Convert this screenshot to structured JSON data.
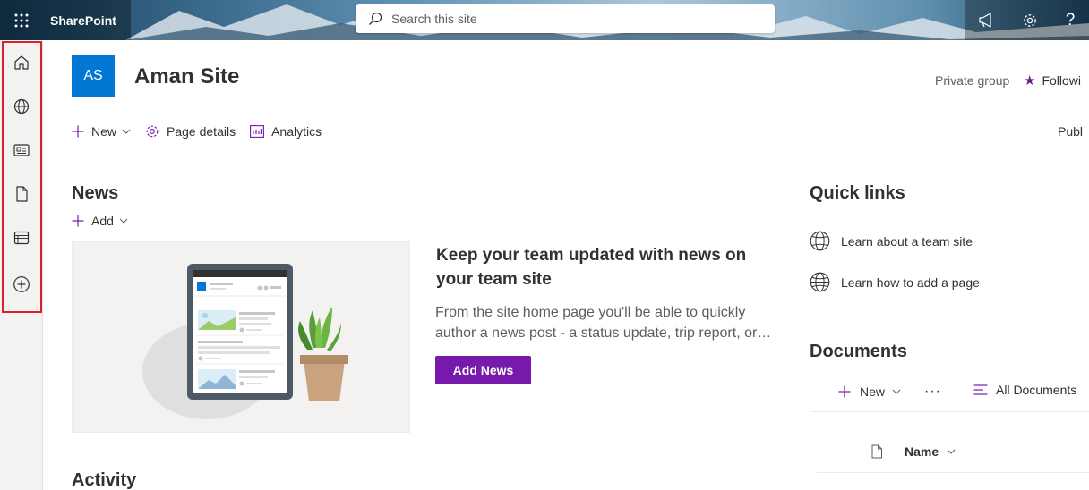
{
  "suite": {
    "app_name": "SharePoint",
    "search_placeholder": "Search this site"
  },
  "site": {
    "logo_initials": "AS",
    "title": "Aman Site",
    "privacy": "Private group",
    "follow_label": "Followi"
  },
  "commands": {
    "new_label": "New",
    "page_details_label": "Page details",
    "analytics_label": "Analytics",
    "publish_label": "Publ"
  },
  "news": {
    "title": "News",
    "add_label": "Add",
    "promo_title": "Keep your team updated with news on your team site",
    "promo_text": "From the site home page you'll be able to quickly author a news post - a status update, trip report, or…",
    "add_news_label": "Add News"
  },
  "activity": {
    "title": "Activity"
  },
  "quick_links": {
    "title": "Quick links",
    "items": [
      {
        "label": "Learn about a team site",
        "icon": "globe-icon"
      },
      {
        "label": "Learn how to add a page",
        "icon": "globe-icon"
      }
    ]
  },
  "documents": {
    "title": "Documents",
    "new_label": "New",
    "more_label": "···",
    "view_label": "All Documents",
    "column_name": "Name"
  },
  "colors": {
    "accent": "#7719aa",
    "site_logo": "#0078d4",
    "highlight": "#d8202e"
  }
}
